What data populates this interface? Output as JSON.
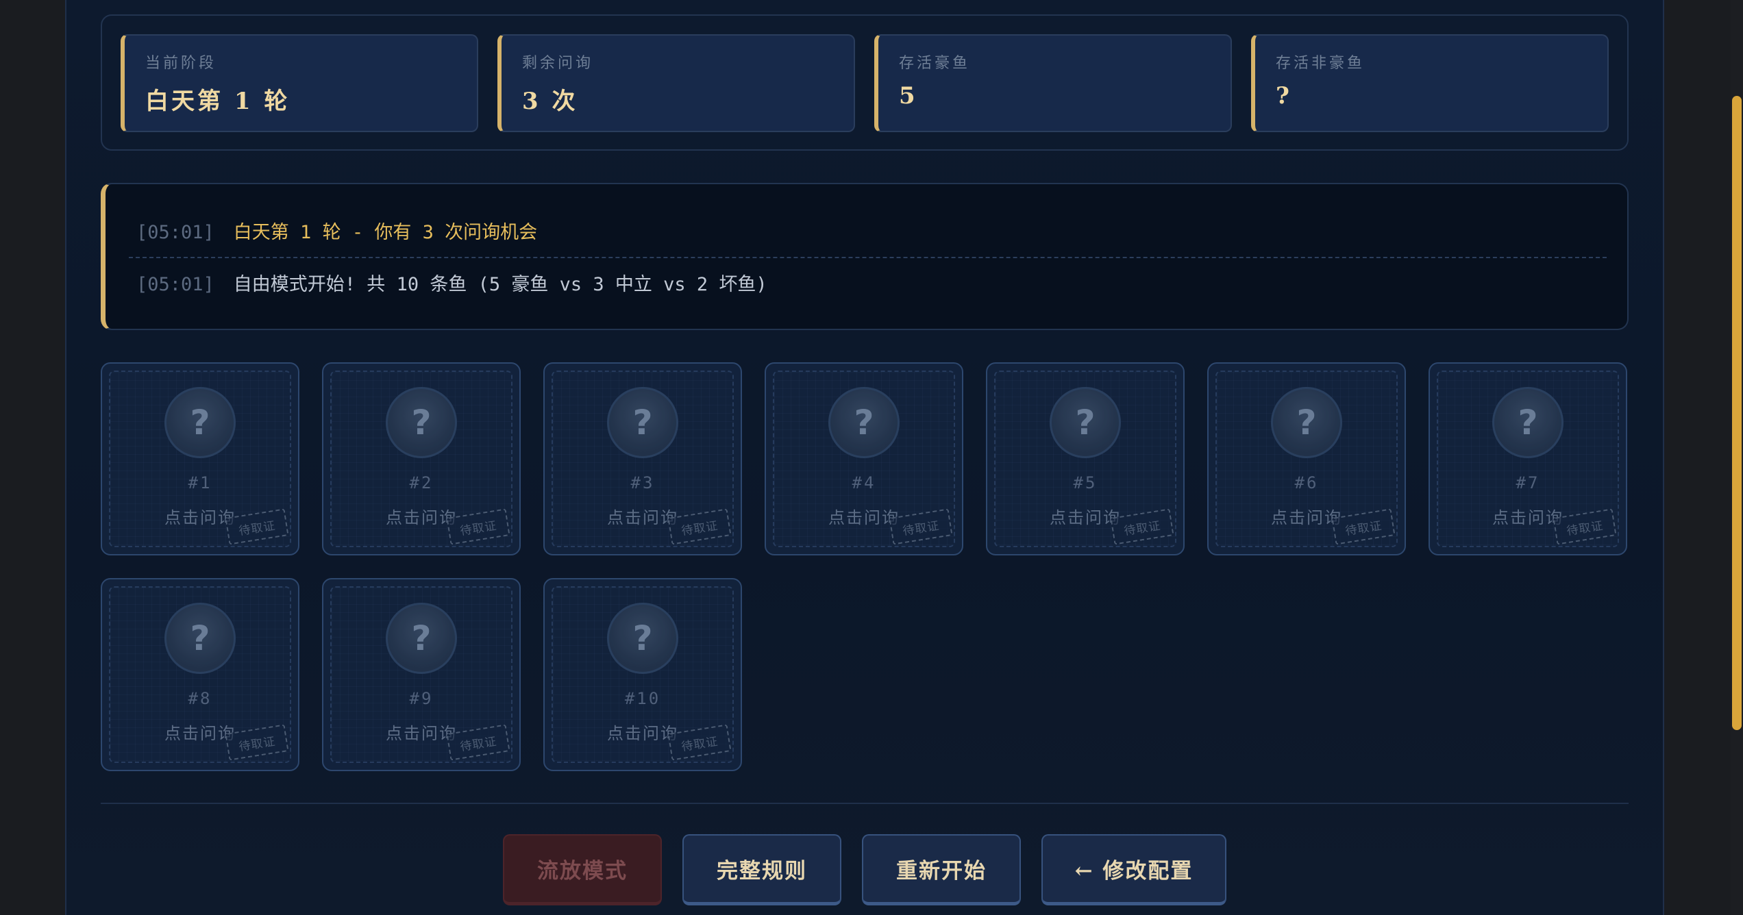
{
  "stats": [
    {
      "label": "当前阶段",
      "value": "白天第 1 轮"
    },
    {
      "label": "剩余问询",
      "value": "3 次"
    },
    {
      "label": "存活豪鱼",
      "value": "5"
    },
    {
      "label": "存活非豪鱼",
      "value": "?"
    }
  ],
  "log": [
    {
      "time": "[05:01]",
      "text": "白天第 1 轮 - 你有 3 次问询机会"
    },
    {
      "time": "[05:01]",
      "text": "自由模式开始! 共 10 条鱼 (5 豪鱼 vs 3 中立 vs 2 坏鱼)"
    }
  ],
  "fish": [
    {
      "avatar": "?",
      "number": "#1",
      "action": "点击问询",
      "stamp": "待取证"
    },
    {
      "avatar": "?",
      "number": "#2",
      "action": "点击问询",
      "stamp": "待取证"
    },
    {
      "avatar": "?",
      "number": "#3",
      "action": "点击问询",
      "stamp": "待取证"
    },
    {
      "avatar": "?",
      "number": "#4",
      "action": "点击问询",
      "stamp": "待取证"
    },
    {
      "avatar": "?",
      "number": "#5",
      "action": "点击问询",
      "stamp": "待取证"
    },
    {
      "avatar": "?",
      "number": "#6",
      "action": "点击问询",
      "stamp": "待取证"
    },
    {
      "avatar": "?",
      "number": "#7",
      "action": "点击问询",
      "stamp": "待取证"
    },
    {
      "avatar": "?",
      "number": "#8",
      "action": "点击问询",
      "stamp": "待取证"
    },
    {
      "avatar": "?",
      "number": "#9",
      "action": "点击问询",
      "stamp": "待取证"
    },
    {
      "avatar": "?",
      "number": "#10",
      "action": "点击问询",
      "stamp": "待取证"
    }
  ],
  "buttons": {
    "exile_mode": "流放模式",
    "full_rules": "完整规则",
    "restart": "重新开始",
    "edit_config": "← 修改配置"
  },
  "colors": {
    "accent_gold": "#d6b36a",
    "log_highlight": "#e7be5c",
    "background": "#0d1a2e",
    "disabled_button": "#3a1c22"
  }
}
